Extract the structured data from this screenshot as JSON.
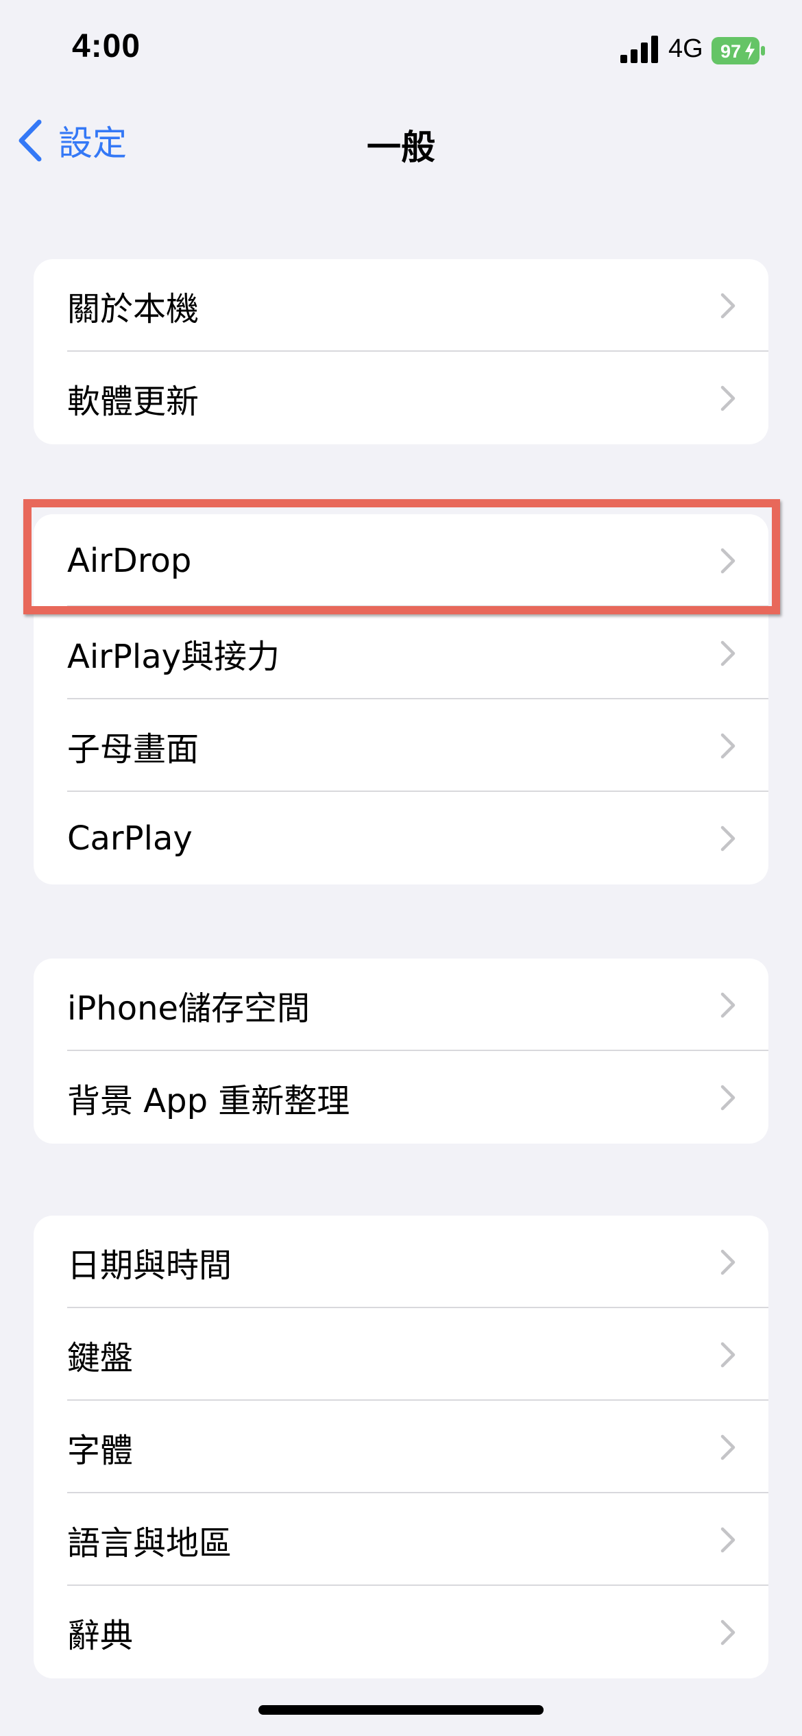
{
  "status_bar": {
    "time": "4:00",
    "network": "4G",
    "battery": "97",
    "battery_color": "#65c466"
  },
  "nav": {
    "back_label": "設定",
    "title": "一般"
  },
  "groups": [
    {
      "items": [
        "關於本機",
        "軟體更新"
      ]
    },
    {
      "items": [
        "AirDrop",
        "AirPlay與接力",
        "子母畫面",
        "CarPlay"
      ]
    },
    {
      "items": [
        "iPhone儲存空間",
        "背景 App 重新整理"
      ]
    },
    {
      "items": [
        "日期與時間",
        "鍵盤",
        "字體",
        "語言與地區",
        "辭典"
      ]
    }
  ],
  "icons": {
    "back": "chevron-left-icon",
    "row_disclosure": "chevron-right-icon"
  },
  "colors": {
    "accent": "#3478f6",
    "background": "#f2f2f7",
    "highlight_border": "#e8685a"
  },
  "highlight_target": "AirDrop"
}
